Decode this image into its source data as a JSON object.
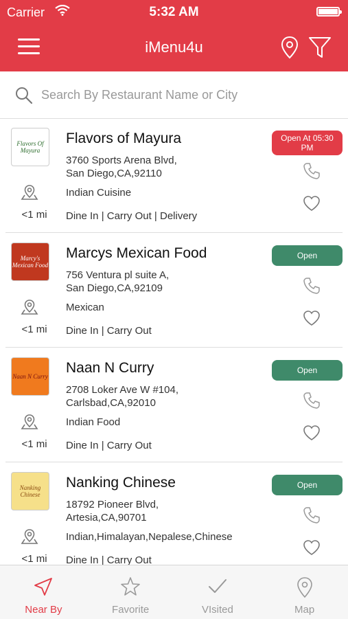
{
  "status": {
    "carrier": "Carrier",
    "time": "5:32 AM"
  },
  "navbar": {
    "title": "iMenu4u"
  },
  "search": {
    "placeholder": "Search By Restaurant Name or City"
  },
  "restaurants": [
    {
      "name": "Flavors of Mayura",
      "address": "3760 Sports Arena Blvd,\nSan Diego,CA,92110",
      "cuisine": "Indian Cuisine",
      "services": "Dine In | Carry Out | Delivery",
      "distance": "<1 mi",
      "status": "Open At 05:30 PM",
      "status_color": "#e23c47",
      "logo_text": "Flavors Of Mayura",
      "logo_bg": "#ffffff",
      "logo_fg": "#2a6b2a"
    },
    {
      "name": "Marcys Mexican Food",
      "address": "756 Ventura pl suite A,\nSan Diego,CA,92109",
      "cuisine": "Mexican",
      "services": "Dine In | Carry Out",
      "distance": "<1 mi",
      "status": "Open",
      "status_color": "#3f8a6a",
      "logo_text": "Marcy's Mexican Food",
      "logo_bg": "#c0381f",
      "logo_fg": "#ffffff"
    },
    {
      "name": "Naan N Curry",
      "address": "2708 Loker Ave W #104,\nCarlsbad,CA,92010",
      "cuisine": "Indian Food",
      "services": "Dine In | Carry Out",
      "distance": "<1 mi",
      "status": "Open",
      "status_color": "#3f8a6a",
      "logo_text": "Naan N Curry",
      "logo_bg": "#f07a1e",
      "logo_fg": "#7a1010"
    },
    {
      "name": "Nanking Chinese",
      "address": "18792 Pioneer Blvd,\nArtesia,CA,90701",
      "cuisine": "Indian,Himalayan,Nepalese,Chinese",
      "services": "Dine In | Carry Out",
      "distance": "<1 mi",
      "status": "Open",
      "status_color": "#3f8a6a",
      "logo_text": "Nanking Chinese",
      "logo_bg": "#f6e08a",
      "logo_fg": "#8a4a10"
    }
  ],
  "tabs": [
    {
      "label": "Near By",
      "icon": "navigation-arrow-icon",
      "active": true
    },
    {
      "label": "Favorite",
      "icon": "star-icon",
      "active": false
    },
    {
      "label": "VIsited",
      "icon": "checkmark-icon",
      "active": false
    },
    {
      "label": "Map",
      "icon": "map-pin-icon",
      "active": false
    }
  ],
  "colors": {
    "brand": "#e23c47",
    "open": "#3f8a6a"
  }
}
